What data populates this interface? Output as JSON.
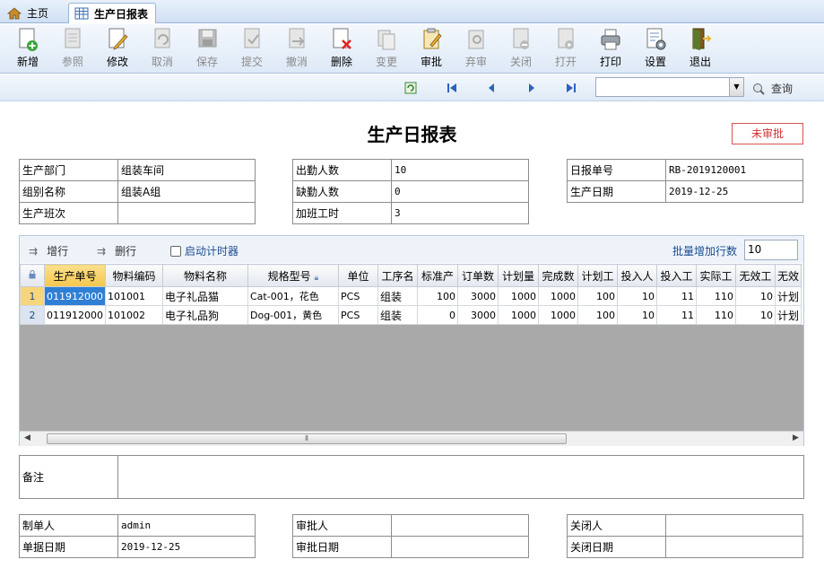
{
  "tabs": {
    "home": "主页",
    "active": "生产日报表"
  },
  "toolbar": [
    {
      "label": "新增",
      "icon": "add-document-icon",
      "enabled": true
    },
    {
      "label": "参照",
      "icon": "reference-icon",
      "enabled": false
    },
    {
      "label": "修改",
      "icon": "edit-icon",
      "enabled": true
    },
    {
      "label": "取消",
      "icon": "undo-icon",
      "enabled": false
    },
    {
      "label": "保存",
      "icon": "save-icon",
      "enabled": false
    },
    {
      "label": "提交",
      "icon": "submit-icon",
      "enabled": false
    },
    {
      "label": "撤消",
      "icon": "revoke-icon",
      "enabled": false
    },
    {
      "label": "删除",
      "icon": "delete-icon",
      "enabled": true
    },
    {
      "label": "变更",
      "icon": "change-icon",
      "enabled": false
    },
    {
      "label": "审批",
      "icon": "approve-icon",
      "enabled": true
    },
    {
      "label": "弃审",
      "icon": "unapprove-icon",
      "enabled": false
    },
    {
      "label": "关闭",
      "icon": "close-doc-icon",
      "enabled": false
    },
    {
      "label": "打开",
      "icon": "open-doc-icon",
      "enabled": false
    },
    {
      "label": "打印",
      "icon": "printer-icon",
      "enabled": true
    },
    {
      "label": "设置",
      "icon": "settings-icon",
      "enabled": true
    },
    {
      "label": "退出",
      "icon": "exit-door-icon",
      "enabled": true
    }
  ],
  "nav": {
    "query": "查询",
    "combo_value": ""
  },
  "title": "生产日报表",
  "status": "未审批",
  "header": {
    "dept_label": "生产部门",
    "dept_value": "组装车间",
    "group_label": "组别名称",
    "group_value": "组装A组",
    "shift_label": "生产班次",
    "shift_value": "",
    "attend_label": "出勤人数",
    "attend_value": "10",
    "absent_label": "缺勤人数",
    "absent_value": "0",
    "overtime_label": "加班工时",
    "overtime_value": "3",
    "report_no_label": "日报单号",
    "report_no_value": "RB-2019120001",
    "prod_date_label": "生产日期",
    "prod_date_value": "2019-12-25"
  },
  "grid_tools": {
    "add_row": "增行",
    "del_row": "删行",
    "timer": "启动计时器",
    "batch_label": "批量增加行数",
    "batch_value": "10"
  },
  "grid": {
    "columns": [
      "生产单号",
      "物料编码",
      "物料名称",
      "规格型号",
      "单位",
      "工序名",
      "标准产",
      "订单数",
      "计划量",
      "完成数",
      "计划工",
      "投入人",
      "投入工",
      "实际工",
      "无效工",
      "无效"
    ],
    "rows": [
      {
        "rn": "1",
        "cells": [
          "011912000",
          "101001",
          "电子礼品猫",
          "Cat-001，花色",
          "PCS",
          "组装",
          "100",
          "3000",
          "1000",
          "1000",
          "100",
          "10",
          "11",
          "110",
          "10",
          "计划"
        ]
      },
      {
        "rn": "2",
        "cells": [
          "011912000",
          "101002",
          "电子礼品狗",
          "Dog-001，黄色",
          "PCS",
          "组装",
          "0",
          "3000",
          "1000",
          "1000",
          "100",
          "10",
          "11",
          "110",
          "10",
          "计划"
        ]
      }
    ]
  },
  "remark": {
    "label": "备注",
    "value": ""
  },
  "footer": {
    "maker_label": "制单人",
    "maker_value": "admin",
    "doc_date_label": "单据日期",
    "doc_date_value": "2019-12-25",
    "approver_label": "审批人",
    "approver_value": "",
    "approve_date_label": "审批日期",
    "approve_date_value": "",
    "closer_label": "关闭人",
    "closer_value": "",
    "close_date_label": "关闭日期",
    "close_date_value": ""
  }
}
